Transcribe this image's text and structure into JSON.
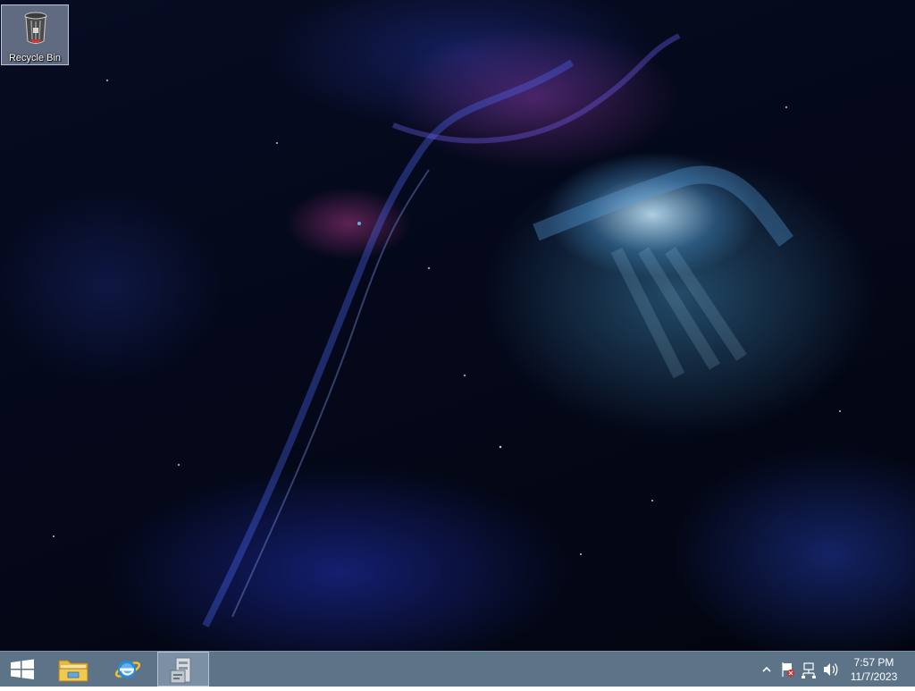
{
  "desktop": {
    "icons": [
      {
        "label": "Recycle Bin",
        "icon": "recycle-bin-icon",
        "selected": true
      }
    ]
  },
  "taskbar": {
    "start_icon": "windows-logo-icon",
    "pinned": [
      {
        "icon": "file-explorer-icon",
        "active": false
      },
      {
        "icon": "internet-explorer-icon",
        "active": false
      },
      {
        "icon": "server-manager-icon",
        "active": true
      }
    ],
    "tray": {
      "icons": [
        "show-hidden-icons-chevron",
        "action-center-flag-icon",
        "network-icon",
        "volume-icon"
      ]
    },
    "clock": {
      "time": "7:57 PM",
      "date": "11/7/2023"
    }
  },
  "colors": {
    "taskbar": "#5d7387",
    "desktop_background": "#04081a"
  }
}
